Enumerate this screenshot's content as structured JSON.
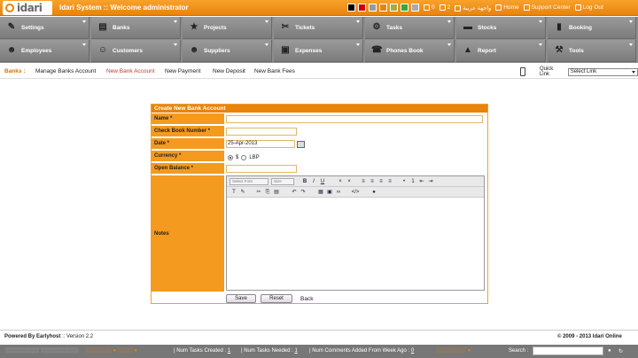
{
  "app": {
    "logo_text": "idari",
    "title": "Idari System :: Welcome administrator"
  },
  "header": {
    "swatch_colors": [
      "#000000",
      "#cc0000",
      "#999999",
      "#e8830c",
      "#aaaa44",
      "#33aa33",
      "#aaaaaa"
    ],
    "mail_count": "0",
    "tasks_count": "2",
    "language_link": "واجهة عربية",
    "home_label": "Home",
    "support_label": "Support Center",
    "logout_label": "Log Out"
  },
  "menu": {
    "row1": [
      {
        "label": "Settings",
        "icon": "wrench-icon"
      },
      {
        "label": "Banks",
        "icon": "bank-icon"
      },
      {
        "label": "Projects",
        "icon": "star-icon"
      },
      {
        "label": "Tickets",
        "icon": "ticket-icon"
      },
      {
        "label": "Tasks",
        "icon": "tasks-icon"
      },
      {
        "label": "Stocks",
        "icon": "truck-icon"
      },
      {
        "label": "Booking",
        "icon": "booking-icon"
      }
    ],
    "row2": [
      {
        "label": "Employees",
        "icon": "employees-icon"
      },
      {
        "label": "Customers",
        "icon": "customers-icon"
      },
      {
        "label": "Suppliers",
        "icon": "suppliers-icon"
      },
      {
        "label": "Expenses",
        "icon": "briefcase-icon"
      },
      {
        "label": "Phones Book",
        "icon": "phonebook-icon"
      },
      {
        "label": "Report",
        "icon": "chart-icon"
      },
      {
        "label": "Tools",
        "icon": "tools-icon"
      }
    ]
  },
  "subnav": {
    "section": "Banks :",
    "links": [
      "Manage Banks Account",
      "New Bank Account",
      "New Payment",
      "New Deposit",
      "New Bank Fees"
    ],
    "quick_link_label": "Quick Link",
    "quick_link_value": "Select Link"
  },
  "form": {
    "title": "Create New Bank Account",
    "name_label": "Name *",
    "name_value": "",
    "checkbook_label": "Check Book Number *",
    "checkbook_value": "",
    "date_label": "Date *",
    "date_value": "25-Apr-2013",
    "currency_label": "Currency *",
    "currency_options": [
      "$",
      "LBP"
    ],
    "currency_selected": "$",
    "balance_label": "Open Balance *",
    "balance_value": "",
    "notes_label": "Notes",
    "editor": {
      "font_select": "Select Font",
      "size_select": "Size"
    },
    "save_label": "Save",
    "reset_label": "Reset",
    "back_label": "Back"
  },
  "footer": {
    "powered": "Powered By Earlyhost",
    "version": ":: Version 2.2",
    "copyright": "© 2009 - 2013 Idari Online"
  },
  "statusbar": {
    "tasks_created_label": "| Num Tasks Created :",
    "tasks_created": "1",
    "tasks_needed_label": "| Num Tasks Needed :",
    "tasks_needed": "1",
    "comments_label": "| Num Comments Added From Week Ago :",
    "comments": "0",
    "search_label": "Search :"
  }
}
